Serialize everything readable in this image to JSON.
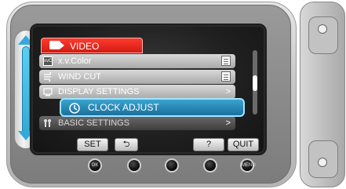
{
  "menu": {
    "title": "VIDEO",
    "items": [
      {
        "label": "x.v.Color",
        "icon": "xvcolor-icon",
        "end": "menu-icon"
      },
      {
        "label": "WIND CUT",
        "icon": "wind-icon",
        "end": "menu-icon"
      },
      {
        "label": "DISPLAY SETTINGS",
        "icon": "display-icon",
        "end": ">"
      },
      {
        "label": "CLOCK ADJUST",
        "icon": "clock-icon",
        "selected": true
      },
      {
        "label": "BASIC SETTINGS",
        "icon": "tools-icon",
        "end": ">"
      }
    ]
  },
  "buttons": {
    "set": "SET",
    "back": "⮌",
    "help": "?",
    "quit": "QUIT"
  },
  "hardware": {
    "ok": "OK",
    "menu": "MENU"
  },
  "colors": {
    "selection": "#2a8bb8",
    "tab": "#e32a20",
    "slider": "#34a9dc"
  }
}
